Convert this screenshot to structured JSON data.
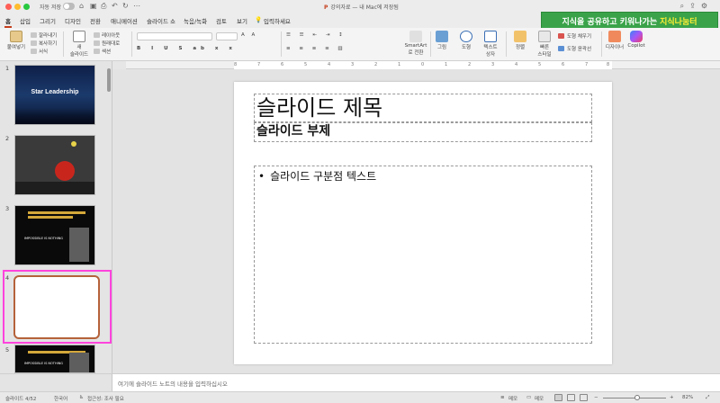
{
  "titlebar": {
    "autosave_label": "자동 저장",
    "doc_title": "강의자료 — 내 Mac에 저장됨",
    "ppt_badge": "P"
  },
  "tabs": [
    "홈",
    "삽입",
    "그리기",
    "디자인",
    "전환",
    "애니메이션",
    "슬라이드 쇼",
    "녹음/녹화",
    "검토",
    "보기",
    "입력하세요"
  ],
  "banner": {
    "text": "지식을 공유하고 키워나가는",
    "highlight": "지식나눔터"
  },
  "ribbon": {
    "paste": "붙여넣기",
    "cut": "잘라내기",
    "copy": "복사하기",
    "format": "서식",
    "new_slide_1": "새",
    "new_slide_2": "슬라이드",
    "layout": "레이아웃",
    "reset": "원래대로",
    "section": "섹션",
    "smartart_1": "SmartArt",
    "smartart_2": "로 전환",
    "picture": "그림",
    "shapes": "도형",
    "textbox_1": "텍스트",
    "textbox_2": "상자",
    "arrange": "정렬",
    "quick_styles_1": "빠른",
    "quick_styles_2": "스타일",
    "shape_fill": "도형 채우기",
    "shape_outline": "도형 윤곽선",
    "designer": "디자이너",
    "copilot": "Copilot"
  },
  "slides": [
    {
      "num": "1",
      "title": "Star Leadership"
    },
    {
      "num": "2",
      "title": ""
    },
    {
      "num": "3",
      "title": "IMPOSSIBLE IS NOTHING"
    },
    {
      "num": "4",
      "title": ""
    },
    {
      "num": "5",
      "title": "IMPOSSIBLE IS NOTHING"
    }
  ],
  "slide": {
    "title": "슬라이드 제목",
    "subtitle": "슬라이드 부제",
    "bullet": "•",
    "body": "슬라이드 구분점 텍스트"
  },
  "notes_placeholder": "여기에 슬라이드 노트의 내용을 입력하십시오",
  "statusbar": {
    "slide_count": "슬라이드 4/52",
    "language": "한국어",
    "accessibility": "접근성: 조사 필요",
    "notes": "메모",
    "comments": "메모",
    "zoom": "82%"
  },
  "ruler_marks": [
    "8",
    "7",
    "6",
    "5",
    "4",
    "3",
    "2",
    "1",
    "0",
    "1",
    "2",
    "3",
    "4",
    "5",
    "6",
    "7",
    "8"
  ],
  "colors": {
    "accent": "#c43e1c",
    "banner": "#3aa34a",
    "banner_highlight": "#ffee33",
    "selection": "#ff44dd"
  }
}
